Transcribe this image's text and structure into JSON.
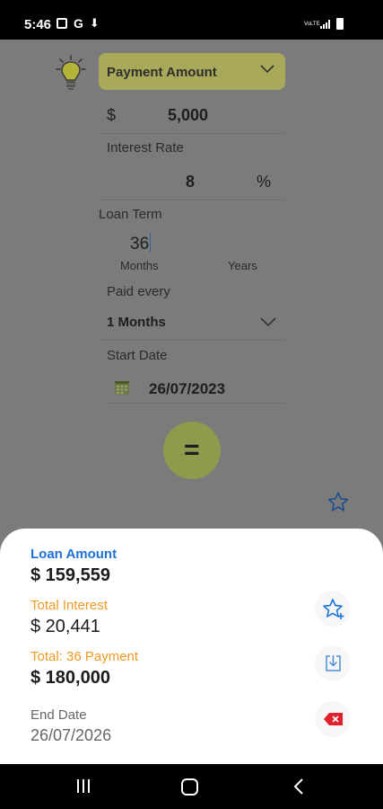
{
  "status_bar": {
    "time": "5:46",
    "left_icons": [
      "image-icon",
      "google-icon",
      "download-icon"
    ],
    "google_glyph": "G",
    "download_glyph": "⬇",
    "network": "VoLTE",
    "right_icons": [
      "volte-icon",
      "signal-icon",
      "battery-icon"
    ]
  },
  "form": {
    "calc_type": "Payment Amount",
    "currency_symbol": "$",
    "amount": "5,000",
    "interest_label": "Interest Rate",
    "interest_value": "8",
    "percent_symbol": "%",
    "loan_term_label": "Loan Term",
    "loan_term_value": "36",
    "term_unit_months": "Months",
    "term_unit_years": "Years",
    "paid_every_label": "Paid every",
    "paid_every_value": "1 Months",
    "start_date_label": "Start Date",
    "start_date_value": "26/07/2023",
    "equals_label": "="
  },
  "result": {
    "loan_amount_label": "Loan Amount",
    "loan_amount_value": "$ 159,559",
    "total_interest_label": "Total Interest",
    "total_interest_value": "$ 20,441",
    "total_payment_label": "Total: 36 Payment",
    "total_payment_value": "$ 180,000",
    "end_date_label": "End Date",
    "end_date_value": "26/07/2026"
  },
  "colors": {
    "accent_blue": "#1f72d8",
    "accent_orange": "#f09a24",
    "delete_red": "#e0202a",
    "select_bg": "#a9a95a"
  }
}
